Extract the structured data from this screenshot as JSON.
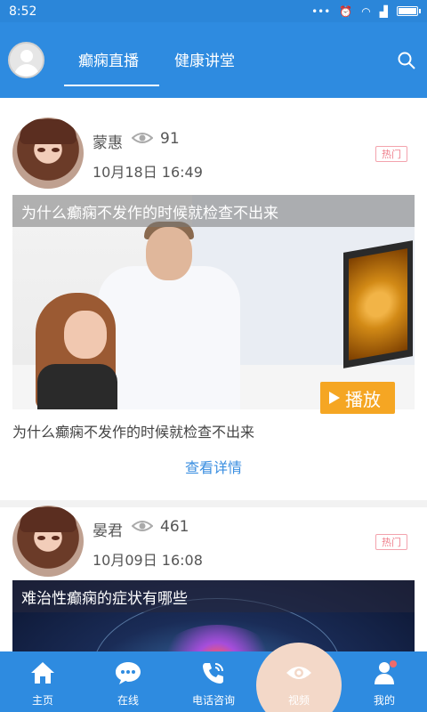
{
  "status_bar": {
    "time": "8:52",
    "icons": [
      "dots-icon",
      "alarm-icon",
      "wifi-icon",
      "signal-icon",
      "battery-icon"
    ]
  },
  "header": {
    "tabs": [
      {
        "label": "癫痫直播",
        "active": true
      },
      {
        "label": "健康讲堂",
        "active": false
      }
    ]
  },
  "posts": [
    {
      "author": "蒙惠",
      "views": "91",
      "date": "10月18日 16:49",
      "hot_label": "热门",
      "overlay_title": "为什么癫痫不发作的时候就检查不出来",
      "play_label": "播放",
      "caption": "为什么癫痫不发作的时候就检查不出来",
      "details_label": "查看详情"
    },
    {
      "author": "晏君",
      "views": "461",
      "date": "10月09日 16:08",
      "hot_label": "热门",
      "overlay_title": "难治性癫痫的症状有哪些"
    }
  ],
  "bottom_nav": [
    {
      "label": "主页",
      "icon": "home-icon"
    },
    {
      "label": "在线",
      "icon": "chat-icon"
    },
    {
      "label": "电话咨询",
      "icon": "phone-icon"
    },
    {
      "label": "视频",
      "icon": "eye-icon",
      "active": true
    },
    {
      "label": "我的",
      "icon": "user-icon"
    }
  ],
  "colors": {
    "primary": "#2e8be0",
    "hot": "#ef7f8c",
    "play": "#f5a623",
    "link": "#3a8ee0"
  }
}
